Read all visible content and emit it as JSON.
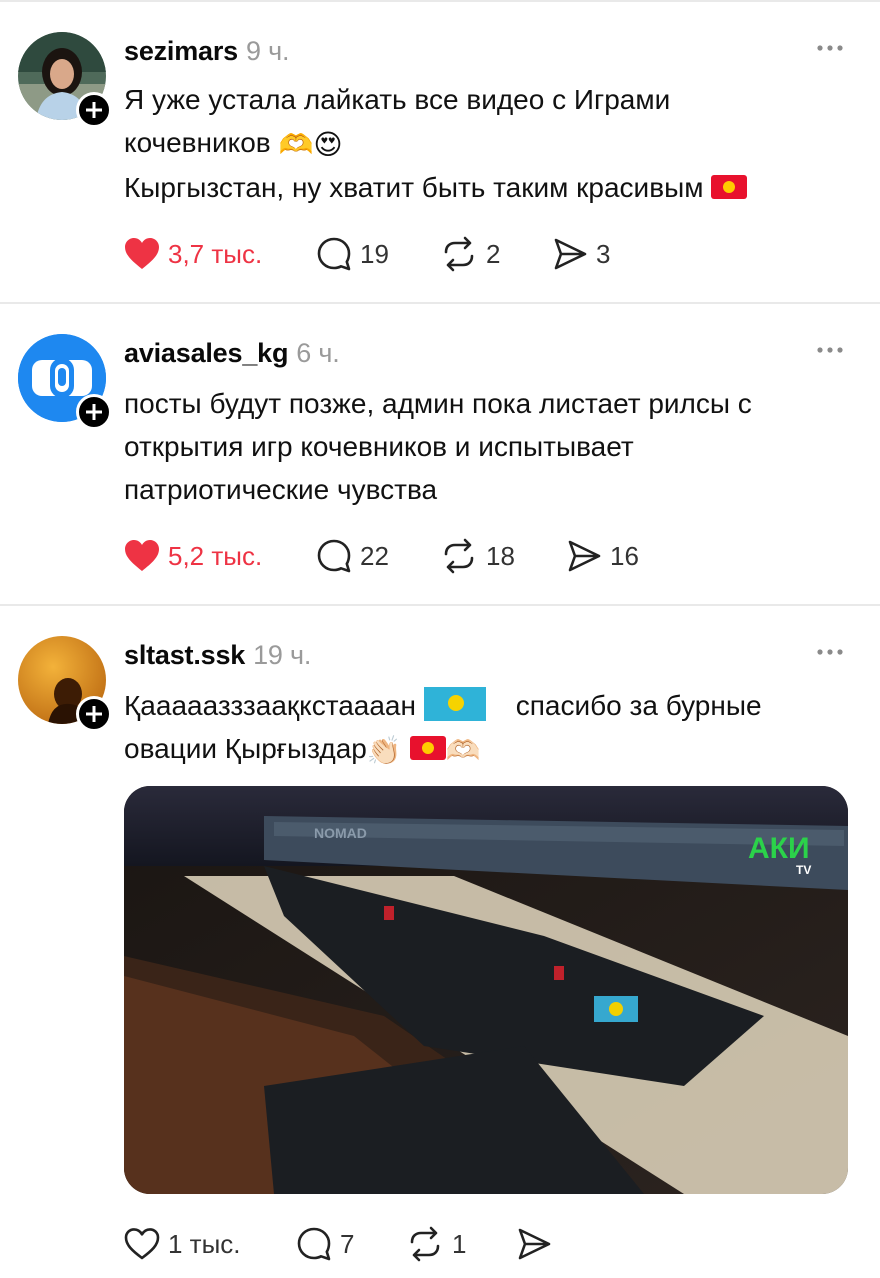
{
  "posts": [
    {
      "username": "sezimars",
      "time": "9 ч.",
      "lines": [
        "Я уже устала лайкать все видео с Играми",
        "кочевников",
        "Кыргызстан, ну хватит быть таким красивым"
      ],
      "likes": "3,7 тыс.",
      "comments": "19",
      "reposts": "2",
      "shares": "3",
      "liked": true,
      "avatar_icon": "profile-photo",
      "emoji": [
        "🫶",
        "😍"
      ]
    },
    {
      "username": "aviasales_kg",
      "time": "6 ч.",
      "lines": [
        "посты будут позже, админ пока листает рилсы с",
        "открытия игр кочевников и испытывает",
        "патриотические чувства"
      ],
      "likes": "5,2 тыс.",
      "comments": "22",
      "reposts": "18",
      "shares": "16",
      "liked": true,
      "avatar_icon": "aviasales-logo"
    },
    {
      "username": "sltast.ssk",
      "time": "19 ч.",
      "lines": [
        "Қааааазззаақкстаааан",
        "спасибо за бурные",
        "овации Қырғыздар"
      ],
      "likes": "1 тыс.",
      "comments": "7",
      "reposts": "1",
      "shares": "",
      "liked": false,
      "avatar_icon": "profile-photo",
      "emoji": [
        "👏🏻",
        "🫶🏻"
      ],
      "media_watermark": "АКИ",
      "media_watermark_sub": "TV",
      "media_banner": "NOMAD"
    }
  ],
  "colors": {
    "like": "#ee3344",
    "accent_blue": "#1e88f0"
  }
}
